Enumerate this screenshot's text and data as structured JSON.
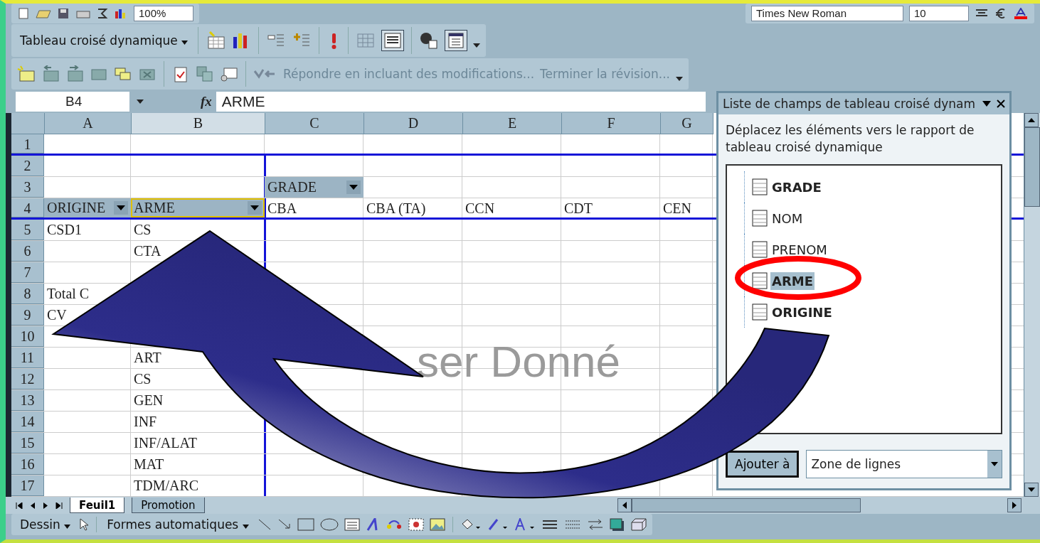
{
  "toolbar_top": {
    "zoom": "100%",
    "font": "Times New Roman",
    "size": "10"
  },
  "pivot_toolbar": {
    "label": "Tableau croisé dynamique"
  },
  "review_toolbar": {
    "reply": "Répondre en incluant des modifications...",
    "finish": "Terminer la révision..."
  },
  "formula_bar": {
    "cell": "B4",
    "fx": "fx",
    "value": "ARME"
  },
  "columns": [
    {
      "label": "A",
      "selected": false
    },
    {
      "label": "B",
      "selected": true
    },
    {
      "label": "C",
      "selected": false
    },
    {
      "label": "D",
      "selected": false
    },
    {
      "label": "E",
      "selected": false
    },
    {
      "label": "F",
      "selected": false
    },
    {
      "label": "G",
      "selected": false
    }
  ],
  "rows": [
    {
      "num": "1",
      "cells": [
        null,
        null,
        null,
        null,
        null,
        null,
        null
      ]
    },
    {
      "num": "2",
      "cells": [
        null,
        null,
        null,
        null,
        null,
        null,
        null
      ]
    },
    {
      "num": "3",
      "cells": [
        null,
        null,
        {
          "kind": "field",
          "text": "GRADE",
          "selected": false
        },
        null,
        null,
        null,
        null
      ]
    },
    {
      "num": "4",
      "cells": [
        {
          "kind": "field",
          "text": "ORIGINE",
          "selected": false
        },
        {
          "kind": "field",
          "text": "ARME",
          "selected": true
        },
        "CBA",
        "CBA (TA)",
        "CCN",
        "CDT",
        "CEN"
      ]
    },
    {
      "num": "5",
      "cells": [
        "CSD1",
        "CS",
        null,
        null,
        null,
        null,
        null
      ]
    },
    {
      "num": "6",
      "cells": [
        null,
        "CTA",
        null,
        null,
        null,
        null,
        null
      ]
    },
    {
      "num": "7",
      "cells": [
        null,
        null,
        null,
        null,
        null,
        null,
        null
      ]
    },
    {
      "num": "8",
      "cells": [
        "Total C",
        null,
        null,
        null,
        null,
        null,
        null
      ]
    },
    {
      "num": "9",
      "cells": [
        "CV",
        null,
        null,
        null,
        null,
        null,
        null
      ]
    },
    {
      "num": "10",
      "cells": [
        null,
        null,
        null,
        null,
        null,
        null,
        null
      ]
    },
    {
      "num": "11",
      "cells": [
        null,
        "ART",
        null,
        null,
        null,
        null,
        null
      ]
    },
    {
      "num": "12",
      "cells": [
        null,
        "CS",
        null,
        null,
        null,
        null,
        null
      ]
    },
    {
      "num": "13",
      "cells": [
        null,
        "GEN",
        null,
        null,
        null,
        null,
        null
      ]
    },
    {
      "num": "14",
      "cells": [
        null,
        "INF",
        null,
        null,
        null,
        null,
        null
      ]
    },
    {
      "num": "15",
      "cells": [
        null,
        "INF/ALAT",
        null,
        null,
        null,
        null,
        null
      ]
    },
    {
      "num": "16",
      "cells": [
        null,
        "MAT",
        null,
        null,
        null,
        null,
        null
      ]
    },
    {
      "num": "17",
      "cells": [
        null,
        "TDM/ARC",
        null,
        null,
        null,
        null,
        null
      ]
    }
  ],
  "drop_zone": "ser Donné",
  "field_pane": {
    "title": "Liste de champs de tableau croisé dynam",
    "description": "Déplacez les éléments vers le rapport de tableau croisé dynamique",
    "fields": [
      {
        "label": "GRADE",
        "in_report": true,
        "selected": false
      },
      {
        "label": "NOM",
        "in_report": false,
        "selected": false
      },
      {
        "label": "PRENOM",
        "in_report": false,
        "selected": false
      },
      {
        "label": "ARME",
        "in_report": true,
        "selected": true
      },
      {
        "label": "ORIGINE",
        "in_report": true,
        "selected": false
      }
    ],
    "add_button": "Ajouter à",
    "area": "Zone de lignes"
  },
  "sheet_tabs": [
    {
      "label": "Feuil1",
      "selected": true
    },
    {
      "label": "Promotion",
      "selected": false
    }
  ],
  "drawing_toolbar": {
    "menu": "Dessin",
    "autoshapes": "Formes automatiques"
  }
}
